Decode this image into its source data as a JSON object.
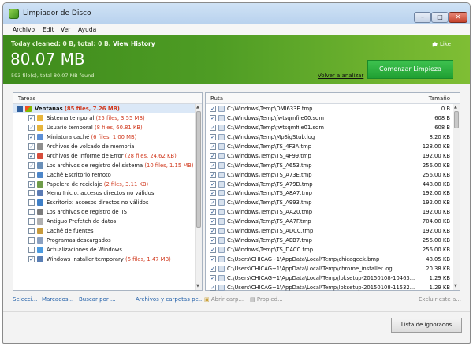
{
  "window": {
    "title": "Limpiador de Disco",
    "min": "–",
    "max": "□",
    "close": "✕"
  },
  "menu": [
    "Archivo",
    "Edit",
    "Ver",
    "Ayuda"
  ],
  "banner": {
    "today_prefix": "Today cleaned: 0 B, total: 0 B.",
    "view_history": "View History",
    "total_size": "80.07 MB",
    "found_text": "593 file(s), total 80.07 MB found.",
    "analyze_link": "Volver a analizar",
    "start_button": "Comenzar  Limpieza",
    "like": "Like"
  },
  "left_panel": {
    "header": "Tareas",
    "root": {
      "label": "Ventanas",
      "count": "(85 files, 7.26 MB)"
    },
    "items": [
      {
        "label": "Sistema temporal",
        "count": "(25 files, 3.55 MB)",
        "checked": true,
        "icon": "system-temp-icon"
      },
      {
        "label": "Usuario temporal",
        "count": "(8 files, 60.81 KB)",
        "checked": true,
        "icon": "user-temp-icon"
      },
      {
        "label": "Miniatura caché",
        "count": "(6 files, 1.00 MB)",
        "checked": true,
        "icon": "thumbnail-cache-icon"
      },
      {
        "label": "Archivos de volcado de memoria",
        "count": "",
        "checked": true,
        "icon": "memory-dump-icon"
      },
      {
        "label": "Archivos de Informe de Error",
        "count": "(28 files, 24.62 KB)",
        "checked": true,
        "icon": "error-report-icon"
      },
      {
        "label": "Los archivos de registro del sistema",
        "count": "(10 files, 1.15 MB)",
        "checked": true,
        "icon": "system-log-icon"
      },
      {
        "label": "Caché Escritorio remoto",
        "count": "",
        "checked": false,
        "icon": "remote-desktop-icon"
      },
      {
        "label": "Papelera de reciclaje",
        "count": "(2 files, 3.11 KB)",
        "checked": true,
        "icon": "recycle-bin-icon"
      },
      {
        "label": "Menu Inicio: accesos directos no válidos",
        "count": "",
        "checked": false,
        "icon": "start-menu-icon"
      },
      {
        "label": "Escritorio: accesos directos no válidos",
        "count": "",
        "checked": false,
        "icon": "desktop-icon"
      },
      {
        "label": "Los archivos de registro de IIS",
        "count": "",
        "checked": false,
        "icon": "iis-log-icon"
      },
      {
        "label": "Antiguo Prefetch de datos",
        "count": "",
        "checked": false,
        "icon": "prefetch-icon"
      },
      {
        "label": "Caché de fuentes",
        "count": "",
        "checked": false,
        "icon": "font-cache-icon"
      },
      {
        "label": "Programas descargados",
        "count": "",
        "checked": false,
        "icon": "downloaded-programs-icon"
      },
      {
        "label": "Actualizaciones de Windows",
        "count": "",
        "checked": false,
        "icon": "windows-update-icon"
      },
      {
        "label": "Windows Installer temporary",
        "count": "(6 files, 1.47 MB)",
        "checked": true,
        "icon": "installer-icon"
      }
    ]
  },
  "right_panel": {
    "col_path": "Ruta",
    "col_size": "Tamaño",
    "rows": [
      {
        "path": "C:\\Windows\\Temp\\DMI633E.tmp",
        "size": "0 B"
      },
      {
        "path": "C:\\Windows\\Temp\\fwtsqmfile00.sqm",
        "size": "608 B"
      },
      {
        "path": "C:\\Windows\\Temp\\fwtsqmfile01.sqm",
        "size": "608 B"
      },
      {
        "path": "C:\\Windows\\Temp\\MpSigStub.log",
        "size": "8.20 KB"
      },
      {
        "path": "C:\\Windows\\Temp\\TS_4F3A.tmp",
        "size": "128.00 KB"
      },
      {
        "path": "C:\\Windows\\Temp\\TS_4F99.tmp",
        "size": "192.00 KB"
      },
      {
        "path": "C:\\Windows\\Temp\\TS_A653.tmp",
        "size": "256.00 KB"
      },
      {
        "path": "C:\\Windows\\Temp\\TS_A73E.tmp",
        "size": "256.00 KB"
      },
      {
        "path": "C:\\Windows\\Temp\\TS_A79D.tmp",
        "size": "448.00 KB"
      },
      {
        "path": "C:\\Windows\\Temp\\TS_A8A7.tmp",
        "size": "192.00 KB"
      },
      {
        "path": "C:\\Windows\\Temp\\TS_A993.tmp",
        "size": "192.00 KB"
      },
      {
        "path": "C:\\Windows\\Temp\\TS_AA20.tmp",
        "size": "192.00 KB"
      },
      {
        "path": "C:\\Windows\\Temp\\TS_AA7F.tmp",
        "size": "704.00 KB"
      },
      {
        "path": "C:\\Windows\\Temp\\TS_ADCC.tmp",
        "size": "192.00 KB"
      },
      {
        "path": "C:\\Windows\\Temp\\TS_AEB7.tmp",
        "size": "256.00 KB"
      },
      {
        "path": "C:\\Windows\\Temp\\TS_DACC.tmp",
        "size": "256.00 KB"
      },
      {
        "path": "C:\\Users\\CHICAG~1\\AppData\\Local\\Temp\\chicageek.bmp",
        "size": "48.05 KB"
      },
      {
        "path": "C:\\Users\\CHICAG~1\\AppData\\Local\\Temp\\chrome_installer.log",
        "size": "20.38 KB"
      },
      {
        "path": "C:\\Users\\CHICAG~1\\AppData\\Local\\Temp\\lpksetup-20150108-10463...",
        "size": "1.29 KB"
      },
      {
        "path": "C:\\Users\\CHICAG~1\\AppData\\Local\\Temp\\lpksetup-20150108-11532...",
        "size": "1.29 KB"
      }
    ]
  },
  "bottom": {
    "select": "Selecci...",
    "mark": "Marcados...",
    "search": "Buscar por ...",
    "files_folders": "Archivos y carpetas pe...",
    "open_folder": "Abrir carp...",
    "properties": "Propied...",
    "exclude": "Excluir este a...",
    "ignore_list": "Lista de ignorados"
  },
  "colors": {
    "banner_dark": "#3e8b1c",
    "banner_light": "#7fbe34",
    "start_button": "#2bb040",
    "count_red": "#d0391e"
  }
}
